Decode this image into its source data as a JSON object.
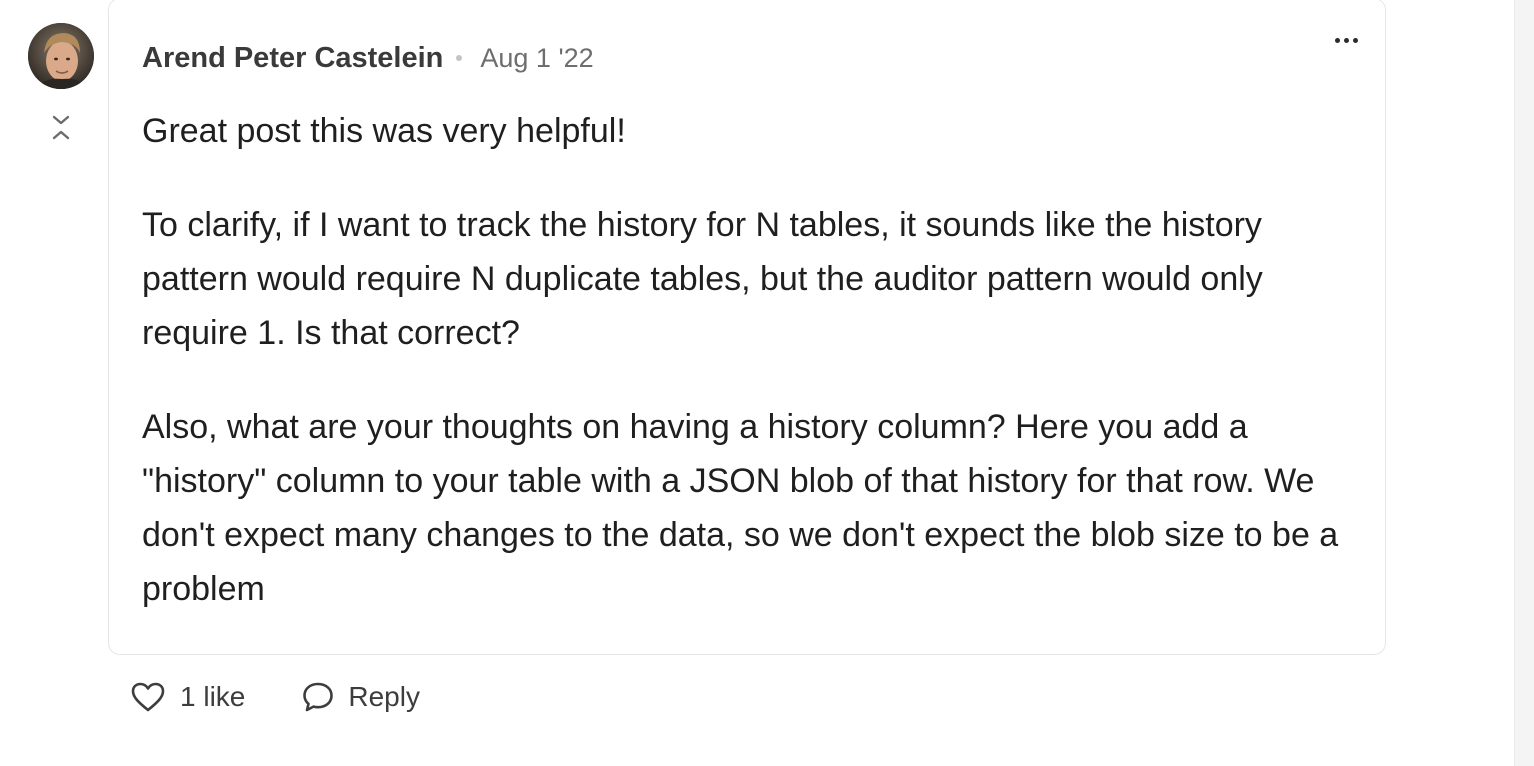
{
  "comment": {
    "author": "Arend Peter Castelein",
    "date": "Aug 1 '22",
    "paragraphs": [
      "Great post this was very helpful!",
      "To clarify, if I want to track the history for N tables, it sounds like the history pattern would require N duplicate tables, but the auditor pattern would only require 1. Is that correct?",
      "Also, what are your thoughts on having a history column? Here you add a \"history\" column to your table with a JSON blob of that history for that row. We don't expect many changes to the data, so we don't expect the blob size to be a problem"
    ]
  },
  "actions": {
    "like_label": "1 like",
    "reply_label": "Reply"
  },
  "icons": {
    "avatar": "avatar-photo",
    "collapse": "collapse-chevrons-icon",
    "more": "more-options-icon",
    "like": "heart-icon",
    "reply": "speech-bubble-icon"
  }
}
